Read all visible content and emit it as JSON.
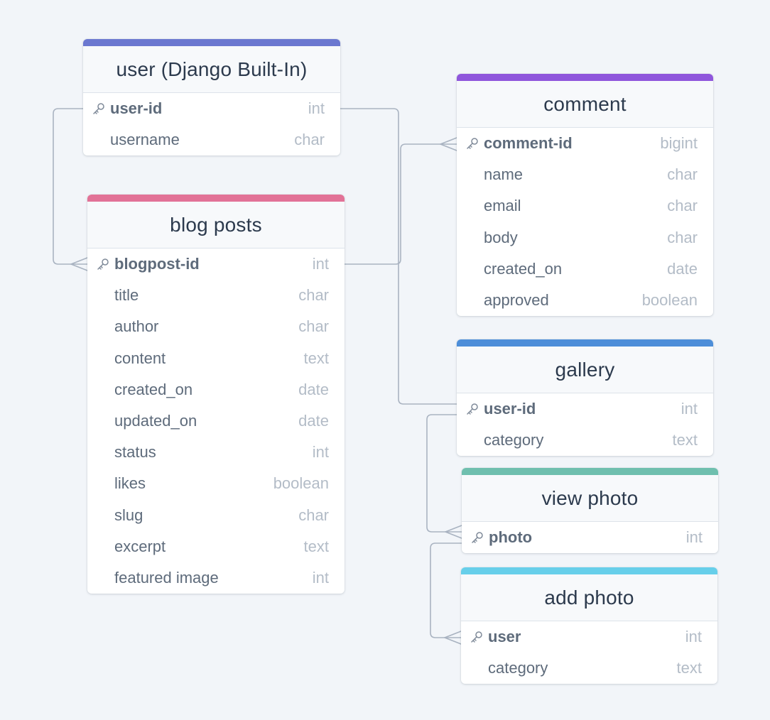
{
  "colors": {
    "background": "#f2f5f9",
    "connector": "#a9b3c1",
    "user_accent": "#6b78d0",
    "blog_accent": "#e27297",
    "comment_accent": "#8f56dc",
    "gallery_accent": "#4d8ed9",
    "view_photo_accent": "#6fbfae",
    "add_photo_accent": "#67cfea"
  },
  "tables": {
    "user": {
      "title": "user (Django Built-In)",
      "fields": [
        {
          "name": "user-id",
          "type": "int",
          "pk": true
        },
        {
          "name": "username",
          "type": "char",
          "pk": false
        }
      ]
    },
    "blog": {
      "title": "blog posts",
      "fields": [
        {
          "name": "blogpost-id",
          "type": "int",
          "pk": true
        },
        {
          "name": "title",
          "type": "char",
          "pk": false
        },
        {
          "name": "author",
          "type": "char",
          "pk": false
        },
        {
          "name": "content",
          "type": "text",
          "pk": false
        },
        {
          "name": "created_on",
          "type": "date",
          "pk": false
        },
        {
          "name": "updated_on",
          "type": "date",
          "pk": false
        },
        {
          "name": "status",
          "type": "int",
          "pk": false
        },
        {
          "name": "likes",
          "type": "boolean",
          "pk": false
        },
        {
          "name": "slug",
          "type": "char",
          "pk": false
        },
        {
          "name": "excerpt",
          "type": "text",
          "pk": false
        },
        {
          "name": "featured image",
          "type": "int",
          "pk": false
        }
      ]
    },
    "comment": {
      "title": "comment",
      "fields": [
        {
          "name": "comment-id",
          "type": "bigint",
          "pk": true
        },
        {
          "name": "name",
          "type": "char",
          "pk": false
        },
        {
          "name": "email",
          "type": "char",
          "pk": false
        },
        {
          "name": "body",
          "type": "char",
          "pk": false
        },
        {
          "name": "created_on",
          "type": "date",
          "pk": false
        },
        {
          "name": "approved",
          "type": "boolean",
          "pk": false
        }
      ]
    },
    "gallery": {
      "title": "gallery",
      "fields": [
        {
          "name": "user-id",
          "type": "int",
          "pk": true
        },
        {
          "name": "category",
          "type": "text",
          "pk": false
        }
      ]
    },
    "view_photo": {
      "title": "view photo",
      "fields": [
        {
          "name": "photo",
          "type": "int",
          "pk": true
        }
      ]
    },
    "add_photo": {
      "title": "add photo",
      "fields": [
        {
          "name": "user",
          "type": "int",
          "pk": true
        },
        {
          "name": "category",
          "type": "text",
          "pk": false
        }
      ]
    }
  }
}
